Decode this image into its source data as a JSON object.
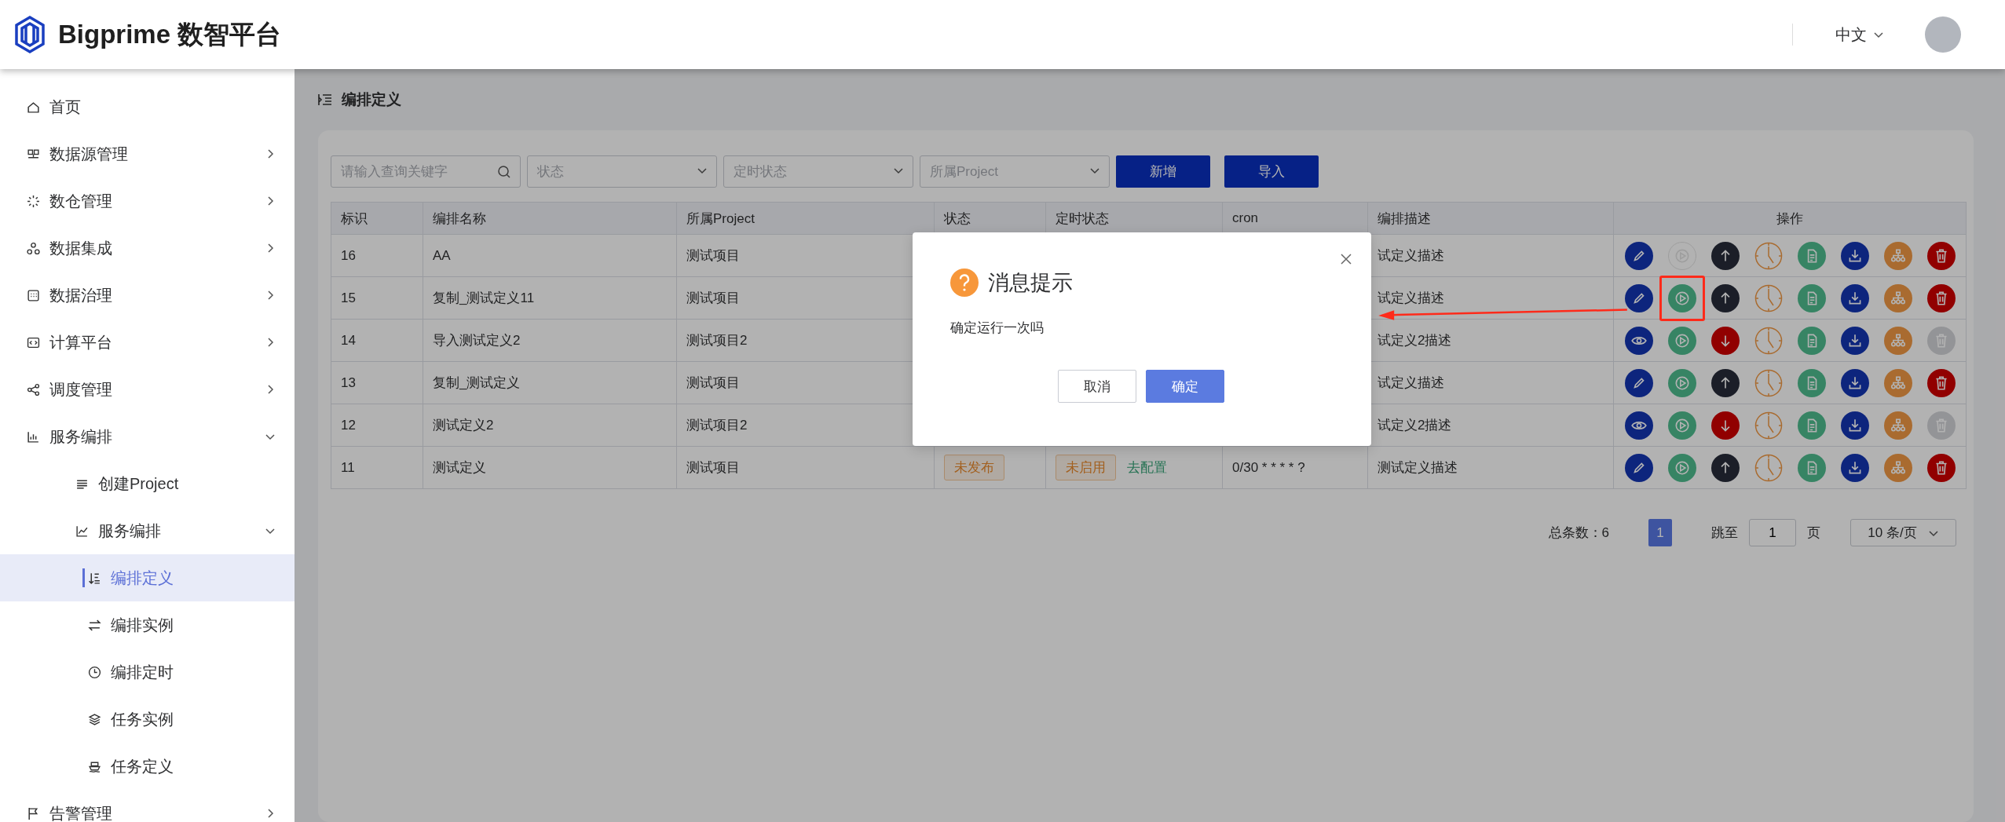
{
  "header": {
    "brand": "Bigprime 数智平台",
    "language": "中文"
  },
  "sidebar": {
    "items": [
      {
        "label": "首页"
      },
      {
        "label": "数据源管理",
        "expanded": false
      },
      {
        "label": "数仓管理",
        "expanded": false
      },
      {
        "label": "数据集成",
        "expanded": false
      },
      {
        "label": "数据治理",
        "expanded": false
      },
      {
        "label": "计算平台",
        "expanded": false
      },
      {
        "label": "调度管理",
        "expanded": false
      },
      {
        "label": "服务编排",
        "expanded": true,
        "children": [
          {
            "label": "创建Project"
          },
          {
            "label": "服务编排",
            "expanded": true,
            "children": [
              {
                "label": "编排定义",
                "selected": true
              },
              {
                "label": "编排实例",
                "selected": false
              },
              {
                "label": "编排定时",
                "selected": false
              },
              {
                "label": "任务实例",
                "selected": false
              },
              {
                "label": "任务定义",
                "selected": false
              }
            ]
          }
        ]
      },
      {
        "label": "告警管理",
        "expanded": false
      }
    ]
  },
  "page_title": "编排定义",
  "filters": {
    "search": {
      "placeholder": "请输入查询关键字"
    },
    "selects": [
      {
        "placeholder": "状态"
      },
      {
        "placeholder": "定时状态"
      },
      {
        "placeholder": "所属Project"
      }
    ],
    "buttons": [
      "新增",
      "导入"
    ]
  },
  "table": {
    "columns": [
      "标识",
      "编排名称",
      "所属Project",
      "状态",
      "定时状态",
      "cron",
      "编排描述",
      "操作"
    ],
    "rows": [
      {
        "id": "16",
        "name": "AA",
        "project": "测试项目",
        "description": "试定义描述",
        "actions": [
          {
            "kind": "edit",
            "disabled": false
          },
          {
            "kind": "run",
            "disabled": true
          },
          {
            "kind": "publish",
            "disabled": false
          },
          {
            "kind": "schedule",
            "disabled": false
          },
          {
            "kind": "copy",
            "disabled": false
          },
          {
            "kind": "download",
            "disabled": false
          },
          {
            "kind": "tree",
            "disabled": false
          },
          {
            "kind": "delete",
            "disabled": false
          }
        ]
      },
      {
        "id": "15",
        "name": "复制_测试定义11",
        "project": "测试项目",
        "description": "试定义描述",
        "actions": [
          {
            "kind": "edit",
            "disabled": false
          },
          {
            "kind": "run",
            "disabled": false,
            "highlighted": true
          },
          {
            "kind": "publish",
            "disabled": false
          },
          {
            "kind": "schedule",
            "disabled": false
          },
          {
            "kind": "copy",
            "disabled": false
          },
          {
            "kind": "download",
            "disabled": false
          },
          {
            "kind": "tree",
            "disabled": false
          },
          {
            "kind": "delete",
            "disabled": false
          }
        ]
      },
      {
        "id": "14",
        "name": "导入测试定义2",
        "project": "测试项目2",
        "description": "试定义2描述",
        "actions": [
          {
            "kind": "view",
            "disabled": false
          },
          {
            "kind": "run",
            "disabled": false
          },
          {
            "kind": "unpublish",
            "disabled": false
          },
          {
            "kind": "schedule",
            "disabled": false
          },
          {
            "kind": "copy",
            "disabled": false
          },
          {
            "kind": "download",
            "disabled": false
          },
          {
            "kind": "tree",
            "disabled": false
          },
          {
            "kind": "delete",
            "disabled": true
          }
        ]
      },
      {
        "id": "13",
        "name": "复制_测试定义",
        "project": "测试项目",
        "description": "试定义描述",
        "actions": [
          {
            "kind": "edit",
            "disabled": false
          },
          {
            "kind": "run",
            "disabled": false
          },
          {
            "kind": "publish",
            "disabled": false
          },
          {
            "kind": "schedule",
            "disabled": false
          },
          {
            "kind": "copy",
            "disabled": false
          },
          {
            "kind": "download",
            "disabled": false
          },
          {
            "kind": "tree",
            "disabled": false
          },
          {
            "kind": "delete",
            "disabled": false
          }
        ]
      },
      {
        "id": "12",
        "name": "测试定义2",
        "project": "测试项目2",
        "description": "试定义2描述",
        "actions": [
          {
            "kind": "view",
            "disabled": false
          },
          {
            "kind": "run",
            "disabled": false
          },
          {
            "kind": "unpublish",
            "disabled": false
          },
          {
            "kind": "schedule",
            "disabled": false
          },
          {
            "kind": "copy",
            "disabled": false
          },
          {
            "kind": "download",
            "disabled": false
          },
          {
            "kind": "tree",
            "disabled": false
          },
          {
            "kind": "delete",
            "disabled": true
          }
        ]
      },
      {
        "id": "11",
        "name": "测试定义",
        "project": "测试项目",
        "status": "未发布",
        "schedule": "未启用",
        "schedule_link": "去配置",
        "cron": "0/30 * * * * ?",
        "description": "测试定义描述",
        "actions": [
          {
            "kind": "edit",
            "disabled": false
          },
          {
            "kind": "run",
            "disabled": false
          },
          {
            "kind": "publish",
            "disabled": false
          },
          {
            "kind": "schedule",
            "disabled": false
          },
          {
            "kind": "copy",
            "disabled": false
          },
          {
            "kind": "download",
            "disabled": false
          },
          {
            "kind": "tree",
            "disabled": false
          },
          {
            "kind": "delete",
            "disabled": false
          }
        ]
      }
    ]
  },
  "pagination": {
    "total": "总条数：6",
    "pages": [
      {
        "label": "1",
        "selected": true
      }
    ],
    "jump_label": "跳至",
    "jump_value": "1",
    "jump_unit": "页",
    "page_size": "10 条/页"
  },
  "dialog": {
    "title": "消息提示",
    "message": "确定运行一次吗",
    "buttons": [
      {
        "label": "取消",
        "kind": "default"
      },
      {
        "label": "确定",
        "kind": "primary"
      }
    ]
  }
}
